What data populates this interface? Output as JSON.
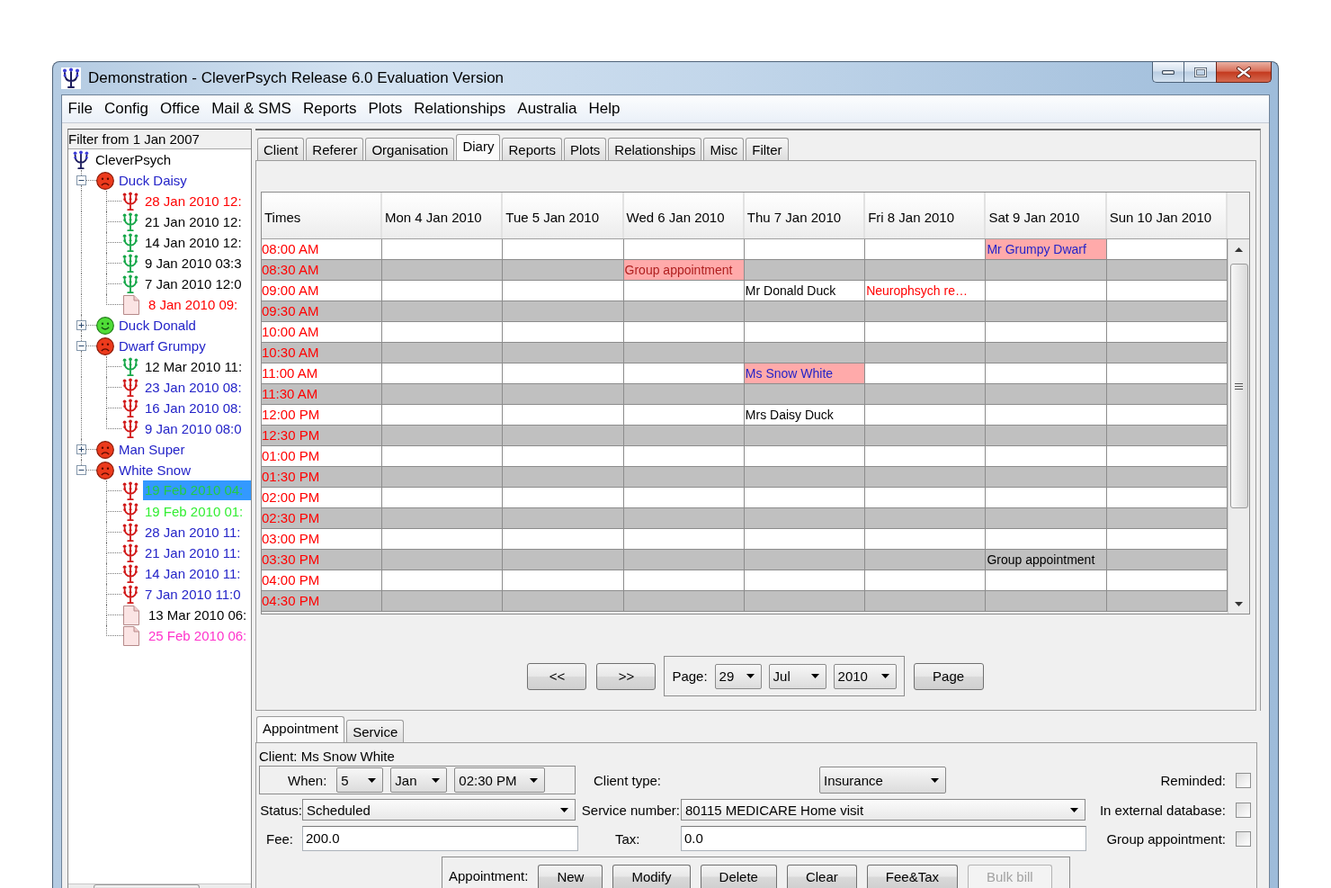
{
  "window": {
    "title": "Demonstration - CleverPsych Release 6.0 Evaluation Version"
  },
  "menu": [
    "File",
    "Config",
    "Office",
    "Mail & SMS",
    "Reports",
    "Plots",
    "Relationships",
    "Australia",
    "Help"
  ],
  "sidebar": {
    "filter": "Filter from 1 Jan 2007",
    "tree": [
      {
        "label": "CleverPsych",
        "kind": "root",
        "color": "#000000",
        "selected": false,
        "children": [
          {
            "label": "Duck Daisy",
            "kind": "frowning",
            "color": "#2323c8",
            "selected": false,
            "expanded": true,
            "children": [
              {
                "label": "28 Jan 2010 12:",
                "kind": "redmark",
                "color": "#ff0000",
                "selected": false
              },
              {
                "label": "21 Jan 2010 12:",
                "kind": "greenmark",
                "color": "#000000",
                "selected": false
              },
              {
                "label": "14 Jan 2010 12:",
                "kind": "greenmark",
                "color": "#000000",
                "selected": false
              },
              {
                "label": "9 Jan 2010 03:3",
                "kind": "greenmark",
                "color": "#000000",
                "selected": false
              },
              {
                "label": "7 Jan 2010 12:0",
                "kind": "greenmark",
                "color": "#000000",
                "selected": false
              },
              {
                "label": "8 Jan 2010 09:",
                "kind": "document",
                "color": "#ff0000",
                "selected": false
              }
            ]
          },
          {
            "label": "Duck Donald",
            "kind": "smiling",
            "color": "#2323c8",
            "selected": false,
            "expanded": false
          },
          {
            "label": "Dwarf Grumpy",
            "kind": "frowning",
            "color": "#2323c8",
            "selected": false,
            "expanded": true,
            "children": [
              {
                "label": "12 Mar 2010 11:",
                "kind": "greenmark",
                "color": "#000000",
                "selected": false
              },
              {
                "label": "23 Jan 2010 08:",
                "kind": "redmark",
                "color": "#2323c8",
                "selected": false
              },
              {
                "label": "16 Jan 2010 08:",
                "kind": "redmark",
                "color": "#2323c8",
                "selected": false
              },
              {
                "label": "9 Jan 2010 08:0",
                "kind": "redmark",
                "color": "#2323c8",
                "selected": false
              }
            ]
          },
          {
            "label": "Man Super",
            "kind": "frowning",
            "color": "#2323c8",
            "selected": false,
            "expanded": false
          },
          {
            "label": "White Snow",
            "kind": "frowning",
            "color": "#2323c8",
            "selected": false,
            "expanded": true,
            "children": [
              {
                "label": "19 Feb 2010 04:",
                "kind": "redmark",
                "color": "#22cc44",
                "selected": true
              },
              {
                "label": "19 Feb 2010 01:",
                "kind": "redmark",
                "color": "#33ee33",
                "selected": false
              },
              {
                "label": "28 Jan 2010 11:",
                "kind": "redmark",
                "color": "#2323c8",
                "selected": false
              },
              {
                "label": "21 Jan 2010 11:",
                "kind": "redmark",
                "color": "#2323c8",
                "selected": false
              },
              {
                "label": "14 Jan 2010 11:",
                "kind": "redmark",
                "color": "#2323c8",
                "selected": false
              },
              {
                "label": "7 Jan 2010 11:0",
                "kind": "redmark",
                "color": "#2323c8",
                "selected": false
              },
              {
                "label": "13 Mar 2010 06:",
                "kind": "document",
                "color": "#000000",
                "selected": false
              },
              {
                "label": "25 Feb 2010 06:",
                "kind": "document",
                "color": "#ff33cc",
                "selected": false
              }
            ]
          }
        ]
      }
    ]
  },
  "tabs": [
    {
      "label": "Client",
      "selected": false
    },
    {
      "label": "Referer",
      "selected": false
    },
    {
      "label": "Organisation",
      "selected": false
    },
    {
      "label": "Diary",
      "selected": true
    },
    {
      "label": "Reports",
      "selected": false
    },
    {
      "label": "Plots",
      "selected": false
    },
    {
      "label": "Relationships",
      "selected": false
    },
    {
      "label": "Misc",
      "selected": false
    },
    {
      "label": "Filter",
      "selected": false
    }
  ],
  "diary": {
    "columns": [
      "Times",
      "Mon 4 Jan 2010",
      "Tue 5 Jan 2010",
      "Wed 6 Jan 2010",
      "Thu 7 Jan 2010",
      "Fri 8 Jan 2010",
      "Sat 9 Jan 2010",
      "Sun 10 Jan 2010"
    ],
    "rows": [
      {
        "time": "08:00 AM",
        "cells": [
          null,
          null,
          null,
          null,
          null,
          {
            "text": "Mr Grumpy Dwarf",
            "color": "#2323c8",
            "highlighted": true
          }
        ]
      },
      {
        "time": "08:30 AM",
        "cells": [
          null,
          null,
          {
            "text": "Group appointment",
            "color": "#b02020",
            "highlighted": true
          }
        ]
      },
      {
        "time": "09:00 AM",
        "cells": [
          null,
          null,
          null,
          {
            "text": "Mr Donald Duck",
            "color": "#000000",
            "highlighted": false
          },
          {
            "text": "Neurophsych re…",
            "color": "#ff0000",
            "highlighted": false
          }
        ]
      },
      {
        "time": "09:30 AM"
      },
      {
        "time": "10:00 AM"
      },
      {
        "time": "10:30 AM"
      },
      {
        "time": "11:00 AM",
        "cells": [
          null,
          null,
          null,
          {
            "text": "Ms Snow White",
            "color": "#2323c8",
            "highlighted": true
          }
        ]
      },
      {
        "time": "11:30 AM"
      },
      {
        "time": "12:00 PM",
        "cells": [
          null,
          null,
          null,
          {
            "text": "Mrs Daisy Duck",
            "color": "#000000",
            "highlighted": false
          }
        ]
      },
      {
        "time": "12:30 PM"
      },
      {
        "time": "01:00 PM"
      },
      {
        "time": "01:30 PM"
      },
      {
        "time": "02:00 PM"
      },
      {
        "time": "02:30 PM"
      },
      {
        "time": "03:00 PM"
      },
      {
        "time": "03:30 PM",
        "cells": [
          null,
          null,
          null,
          null,
          null,
          {
            "text": "Group appointment",
            "color": "#000000",
            "highlighted": false
          }
        ]
      },
      {
        "time": "04:00 PM"
      },
      {
        "time": "04:30 PM"
      }
    ]
  },
  "pager": {
    "previous": "<<",
    "next": ">>",
    "label": "Page:",
    "day": "29",
    "month": "Jul",
    "year": "2010",
    "button": "Page"
  },
  "detail_tabs": [
    {
      "label": "Appointment",
      "selected": true
    },
    {
      "label": "Service",
      "selected": false
    }
  ],
  "appointment": {
    "client": "Client: Ms Snow White",
    "when_label": "When:",
    "day": "5",
    "month": "Jan",
    "time": "02:30 PM",
    "client_type_label": "Client type:",
    "client_type": "Insurance",
    "status_label": "Status:",
    "status": "Scheduled",
    "service_label": "Service number:",
    "service": "80115 MEDICARE Home visit",
    "fee_label": "Fee:",
    "fee": "200.0",
    "tax_label": "Tax:",
    "tax": "0.0",
    "checks": [
      {
        "label": "Reminded:",
        "checked": false
      },
      {
        "label": "In external database:",
        "checked": false
      },
      {
        "label": "Group appointment:",
        "checked": false
      }
    ],
    "actions_label": "Appointment:",
    "actions": [
      {
        "label": "New",
        "disabled": false
      },
      {
        "label": "Modify",
        "disabled": false
      },
      {
        "label": "Delete",
        "disabled": false
      },
      {
        "label": "Clear",
        "disabled": false
      },
      {
        "label": "Fee&Tax",
        "disabled": false
      },
      {
        "label": "Bulk bill",
        "disabled": true
      }
    ]
  }
}
